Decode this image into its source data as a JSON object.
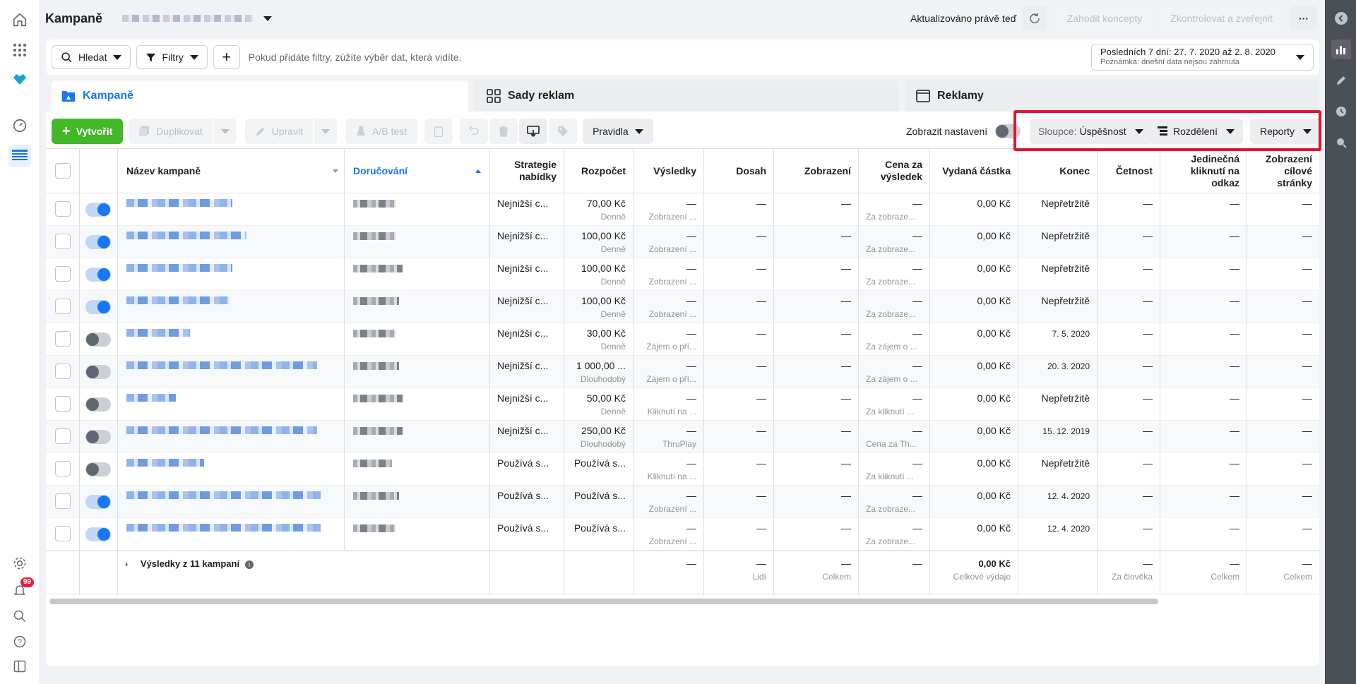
{
  "header": {
    "title": "Kampaně",
    "updated": "Aktualizováno právě teď",
    "discard": "Zahodit koncepty",
    "review": "Zkontrolovat a zveřejnit",
    "more": "···"
  },
  "search": {
    "search_label": "Hledat",
    "filters_label": "Filtry",
    "add": "+",
    "hint": "Pokud přidáte filtry, zúžíte výběr dat, která vidíte.",
    "date_range": "Posledních 7 dní: 27. 7. 2020 až 2. 8. 2020",
    "date_note": "Poznámka: dnešní data nejsou zahrnuta"
  },
  "tabs": [
    {
      "label": "Kampaně"
    },
    {
      "label": "Sady reklam"
    },
    {
      "label": "Reklamy"
    }
  ],
  "toolbar": {
    "create": "Vytvořit",
    "duplicate": "Duplikovat",
    "edit": "Upravit",
    "ab_test": "A/B test",
    "rules": "Pravidla",
    "show_settings": "Zobrazit nastavení",
    "columns_prefix": "Sloupce:",
    "columns_value": "Úspěšnost",
    "breakdown": "Rozdělení",
    "reports": "Reporty"
  },
  "columns": {
    "name": "Název kampaně",
    "delivery": "Doručování",
    "strategy": "Strategie nabídky",
    "budget": "Rozpočet",
    "results": "Výsledky",
    "reach": "Dosah",
    "impressions": "Zobrazení",
    "cost": "Cena za výsledek",
    "spent": "Vydaná částka",
    "end": "Konec",
    "frequency": "Četnost",
    "unique_clicks": "Jedinečná kliknutí na odkaz",
    "landing": "Zobrazení cílové stránky"
  },
  "rows": [
    {
      "on": true,
      "strategy": "Nejnižší c...",
      "budget": "70,00 Kč",
      "budget_type": "Denně",
      "result_type": "Zobrazení ...",
      "cost_type": "Za zobraze...",
      "spent": "0,00 Kč",
      "end": "Nepřetržitě"
    },
    {
      "on": true,
      "strategy": "Nejnižší c...",
      "budget": "100,00 Kč",
      "budget_type": "Denně",
      "result_type": "Zobrazení ...",
      "cost_type": "Za zobraze...",
      "spent": "0,00 Kč",
      "end": "Nepřetržitě"
    },
    {
      "on": true,
      "strategy": "Nejnižší c...",
      "budget": "100,00 Kč",
      "budget_type": "Denně",
      "result_type": "Zobrazení ...",
      "cost_type": "Za zobraze...",
      "spent": "0,00 Kč",
      "end": "Nepřetržitě"
    },
    {
      "on": true,
      "strategy": "Nejnižší c...",
      "budget": "100,00 Kč",
      "budget_type": "Denně",
      "result_type": "Zobrazení ...",
      "cost_type": "Za zobraze...",
      "spent": "0,00 Kč",
      "end": "Nepřetržitě"
    },
    {
      "on": false,
      "strategy": "Nejnižší c...",
      "budget": "30,00 Kč",
      "budget_type": "Denně",
      "result_type": "Zájem o pří...",
      "cost_type": "Za zájem o ...",
      "spent": "0,00 Kč",
      "end": "7. 5. 2020"
    },
    {
      "on": false,
      "strategy": "Nejnižší c...",
      "budget": "1 000,00 ...",
      "budget_type": "Dlouhodobý",
      "result_type": "Zájem o pří...",
      "cost_type": "Za zájem o ...",
      "spent": "0,00 Kč",
      "end": "20. 3. 2020"
    },
    {
      "on": false,
      "strategy": "Nejnižší c...",
      "budget": "50,00 Kč",
      "budget_type": "Denně",
      "result_type": "Kliknutí na ...",
      "cost_type": "Za kliknutí ...",
      "spent": "0,00 Kč",
      "end": "Nepřetržitě"
    },
    {
      "on": false,
      "strategy": "Nejnižší c...",
      "budget": "250,00 Kč",
      "budget_type": "Dlouhodobý",
      "result_type": "ThruPlay",
      "cost_type": "Cena za Th...",
      "spent": "0,00 Kč",
      "end": "15. 12. 2019"
    },
    {
      "on": false,
      "strategy": "Používá s...",
      "budget": "Používá s...",
      "budget_type": "",
      "result_type": "Kliknutí na ...",
      "cost_type": "Za kliknutí ...",
      "spent": "0,00 Kč",
      "end": "Nepřetržitě"
    },
    {
      "on": true,
      "strategy": "Používá s...",
      "budget": "Používá s...",
      "budget_type": "",
      "result_type": "Zobrazení ...",
      "cost_type": "Za zobraze...",
      "spent": "0,00 Kč",
      "end": "12. 4. 2020"
    },
    {
      "on": true,
      "strategy": "Používá s...",
      "budget": "Používá s...",
      "budget_type": "",
      "result_type": "Zobrazení ...",
      "cost_type": "Za zobraze...",
      "spent": "0,00 Kč",
      "end": "12. 4. 2020"
    }
  ],
  "dash": "—",
  "summary": {
    "label": "Výsledky z 11 kampaní",
    "reach_sub": "Lidí",
    "impr_sub": "Celkem",
    "spent": "0,00 Kč",
    "spent_sub": "Celkové výdaje",
    "freq_sub": "Za člověka",
    "clicks_sub": "Celkem",
    "landing_sub": "Celkem"
  },
  "notifications": {
    "count": "99"
  }
}
